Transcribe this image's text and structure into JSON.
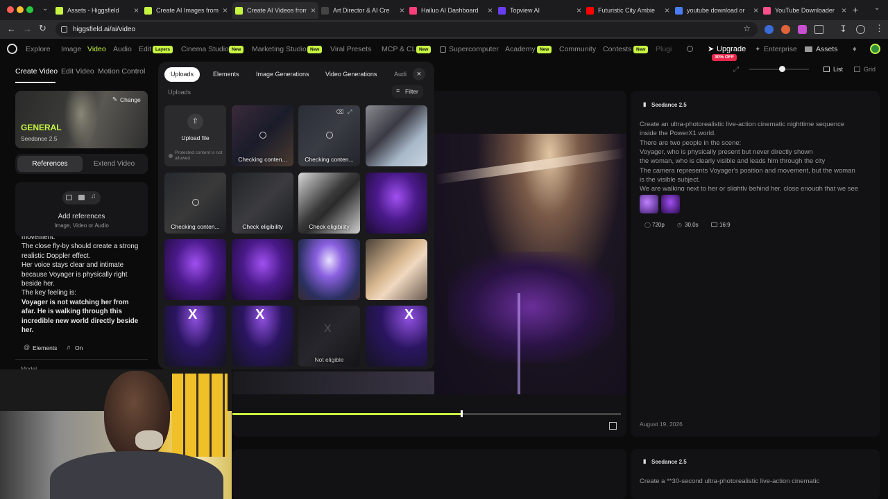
{
  "browser": {
    "tabs": [
      {
        "title": "Assets - Higgsfield",
        "favicon_color": "#c8f542"
      },
      {
        "title": "Create AI Images from",
        "favicon_color": "#c8f542"
      },
      {
        "title": "Create AI Videos from",
        "favicon_color": "#c8f542",
        "active": true
      },
      {
        "title": "Art Director & AI Cre",
        "favicon_color": "#444444"
      },
      {
        "title": "Hailuo AI Dashboard",
        "favicon_color": "#ff3d7a"
      },
      {
        "title": "Topview AI",
        "favicon_color": "#6a3df5"
      },
      {
        "title": "Futuristic City Ambie",
        "favicon_color": "#ff0000"
      },
      {
        "title": "youtube download or",
        "favicon_color": "#4a7cf5"
      },
      {
        "title": "YouTube Downloader",
        "favicon_color": "#ff4f8b"
      }
    ],
    "url": "higgsfield.ai/ai/video"
  },
  "app_nav": {
    "items": [
      "Explore",
      "Image",
      "Video",
      "Audio",
      "Edit",
      "Cinema Studio",
      "Marketing Studio",
      "Viral Presets",
      "MCP & CLI",
      "Supercomputer",
      "Academy",
      "Community",
      "Contests",
      "Plugi"
    ],
    "badges": {
      "edit": "Layers",
      "new": "New"
    },
    "upgrade": "Upgrade",
    "discount": "30% OFF",
    "enterprise": "Enterprise",
    "assets": "Assets",
    "accent": "#c8f542"
  },
  "left_panel": {
    "tabs": [
      "Create Video",
      "Edit Video",
      "Motion Control"
    ],
    "model_tag": "GENERAL",
    "model_name": "Seedance 2.5",
    "change_label": "Change",
    "subtabs": [
      "References",
      "Extend Video"
    ],
    "add_ref_title": "Add references",
    "add_ref_sub": "Image, Video or Audio",
    "prompt_lines": [
      "movement.",
      "The close fly-by should create a strong",
      "realistic Doppler effect.",
      "Her voice stays clear and intimate",
      "because Voyager is physically right",
      "beside her.",
      "The key feeling is:"
    ],
    "prompt_bold_lines": [
      "Voyager is not watching her from",
      "afar. He is walking through this",
      "incredible new world directly beside",
      "her."
    ],
    "elements_label": "Elements",
    "audio_label": "On",
    "model_label": "Model"
  },
  "uploads_panel": {
    "tabs": [
      "Uploads",
      "Elements",
      "Image Generations",
      "Video Generations",
      "Audi"
    ],
    "section_label": "Uploads",
    "filter_label": "Filter",
    "upload_label": "Upload file",
    "protected_note": "Protected content is not allowed",
    "checking_label": "Checking conten...",
    "check_label": "Check eligibility",
    "not_eligible_label": "Not eligible"
  },
  "player": {
    "view_list": "List",
    "view_grid": "Grid",
    "progress": 0.59
  },
  "generations": [
    {
      "model": "Seedance 2.5",
      "prompt": [
        "Create an ultra-photorealistic live-action cinematic nighttime sequence",
        "inside the PowerX1 world.",
        "There are two people in the scene:",
        "Voyager, who is physically present but never directly shown",
        "the woman, who is clearly visible and leads him through the city",
        "The camera represents Voyager's position and movement, but the woman",
        "is the visible subject.",
        "We are walking next to her or slightly behind her, close enough that we see"
      ],
      "resolution": "720p",
      "duration": "30.0s",
      "aspect": "16:9",
      "date": "August 19, 2026"
    },
    {
      "model": "Seedance 2.5",
      "prompt": [
        "Create a **30-second ultra-photorealistic live-action cinematic"
      ]
    }
  ]
}
